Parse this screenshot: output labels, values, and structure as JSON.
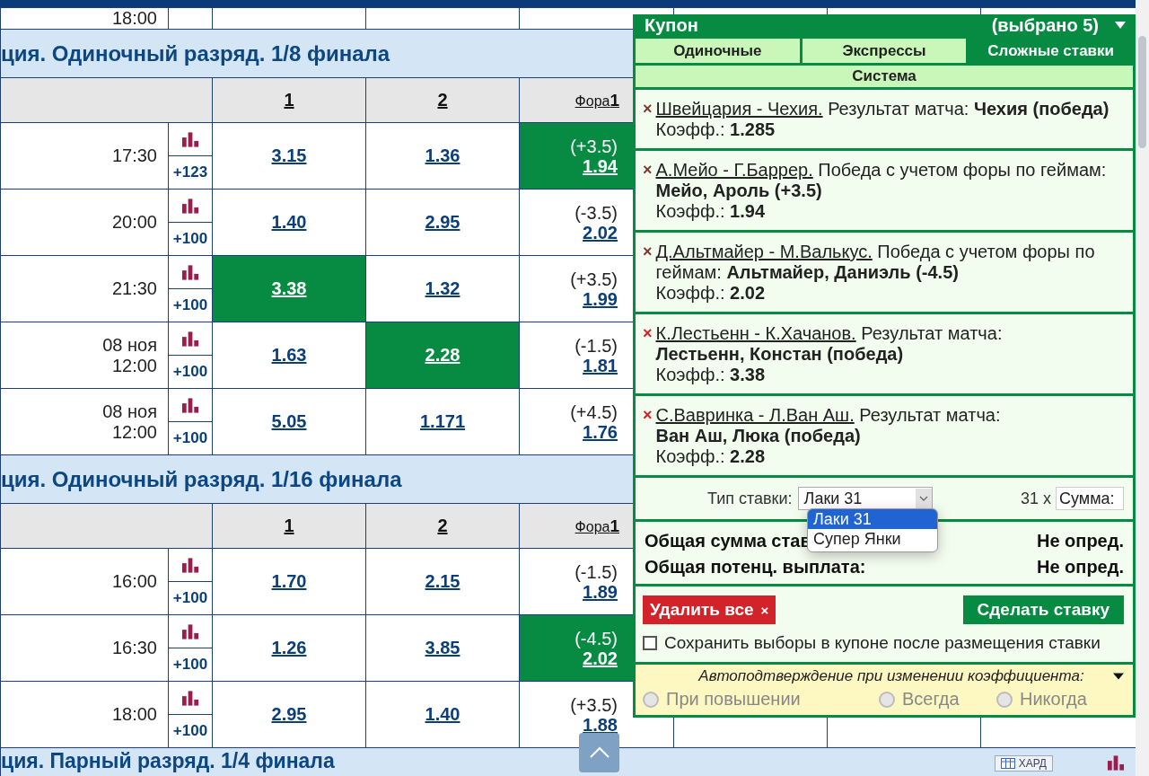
{
  "partial_row": {
    "time": "18:00"
  },
  "sections": [
    {
      "title": "ция. Одиночный разряд. 1/8 финала",
      "columns": [
        "1",
        "2",
        "Фора**1**"
      ],
      "rows": [
        {
          "time": "17:30",
          "more": "+123",
          "odds": [
            {
              "value": "3.15",
              "selected": false
            },
            {
              "value": "1.36",
              "selected": false
            }
          ],
          "handicap": {
            "line": "(+3.5)",
            "value": "1.94",
            "selected": true
          }
        },
        {
          "time": "20:00",
          "more": "+100",
          "odds": [
            {
              "value": "1.40",
              "selected": false
            },
            {
              "value": "2.95",
              "selected": false
            }
          ],
          "handicap": {
            "line": "(-3.5)",
            "value": "2.02",
            "selected": false
          }
        },
        {
          "time": "21:30",
          "more": "+100",
          "odds": [
            {
              "value": "3.38",
              "selected": true
            },
            {
              "value": "1.32",
              "selected": false
            }
          ],
          "handicap": {
            "line": "(+3.5)",
            "value": "1.99",
            "selected": false
          }
        },
        {
          "date": "08 ноя",
          "time": "12:00",
          "more": "+100",
          "odds": [
            {
              "value": "1.63",
              "selected": false
            },
            {
              "value": "2.28",
              "selected": true
            }
          ],
          "handicap": {
            "line": "(-1.5)",
            "value": "1.81",
            "selected": false
          }
        },
        {
          "date": "08 ноя",
          "time": "12:00",
          "more": "+100",
          "odds": [
            {
              "value": "5.05",
              "selected": false
            },
            {
              "value": "1.171",
              "selected": false
            }
          ],
          "handicap": {
            "line": "(+4.5)",
            "value": "1.76",
            "selected": false
          }
        }
      ]
    },
    {
      "title": "ция. Одиночный разряд. 1/16 финала",
      "columns": [
        "1",
        "2",
        "Фора**1**"
      ],
      "rows": [
        {
          "time": "16:00",
          "more": "+100",
          "odds": [
            {
              "value": "1.70",
              "selected": false
            },
            {
              "value": "2.15",
              "selected": false
            }
          ],
          "handicap": {
            "line": "(-1.5)",
            "value": "1.89",
            "selected": false
          }
        },
        {
          "time": "16:30",
          "more": "+100",
          "odds": [
            {
              "value": "1.26",
              "selected": false
            },
            {
              "value": "3.85",
              "selected": false
            }
          ],
          "handicap": {
            "line": "(-4.5)",
            "value": "2.02",
            "selected": true
          }
        },
        {
          "time": "18:00",
          "more": "+100",
          "odds": [
            {
              "value": "2.95",
              "selected": false
            },
            {
              "value": "1.40",
              "selected": false
            }
          ],
          "handicap": {
            "line": "(+3.5)",
            "value": "1.88",
            "selected": false
          }
        }
      ]
    }
  ],
  "next_section": {
    "title": "ция. Парный разряд. 1/4 финала",
    "badge": "ХАРД"
  },
  "coupon": {
    "title": "Купон",
    "count": "(выбрано 5)",
    "tabs": [
      {
        "label": "Одиночные",
        "selected": false
      },
      {
        "label": "Экспрессы",
        "selected": false
      },
      {
        "label": "Сложные ставки",
        "selected": true
      }
    ],
    "subtab": "Система",
    "bets": [
      {
        "match": "Швейцария - Чехия.",
        "market": "Результат матча:",
        "pick": "Чехия (победа)",
        "odds_label": "Коэфф.:",
        "odds": "1.285",
        "remove": "×",
        "color": "#7b3b32"
      },
      {
        "match": "А.Мейо - Г.Баррер.",
        "market": "Победа с учетом форы по геймам:",
        "pick": "Мейо, Ароль (+3.5)",
        "odds_label": "Коэфф.:",
        "odds": "1.94",
        "remove": "×",
        "color": "#7b3b32"
      },
      {
        "match": "Д.Альтмайер - М.Валькус.",
        "market": "Победа с учетом форы по геймам:",
        "pick": "Альтмайер, Даниэль (-4.5)",
        "odds_label": "Коэфф.:",
        "odds": "2.02",
        "remove": "×",
        "color": "#7b3b32"
      },
      {
        "match": "К.Лестьенн - К.Хачанов.",
        "market": "Результат матча:",
        "pick": "Лестьенн, Констан (победа)",
        "odds_label": "Коэфф.:",
        "odds": "3.38",
        "remove": "×",
        "color": "#d42027"
      },
      {
        "match": "С.Вавринка - Л.Ван Аш.",
        "market": "Результат матча:",
        "pick": "Ван Аш, Люка (победа)",
        "odds_label": "Коэфф.:",
        "odds": "2.28",
        "remove": "×",
        "color": "#d42027"
      }
    ],
    "stake": {
      "label": "Тип ставки:",
      "type": "Лаки 31",
      "multiplier": "31 x",
      "placeholder": "Сумма:",
      "options": [
        {
          "label": "Лаки 31",
          "selected": true
        },
        {
          "label": "Супер Янки",
          "selected": false
        }
      ]
    },
    "totals": [
      {
        "label": "Общая сумма став",
        "value": "Не опред."
      },
      {
        "label": "Общая потенц. выплата:",
        "value": "Не опред."
      }
    ],
    "delete_button": {
      "label": "Удалить все",
      "mark": "×"
    },
    "place_button": "Сделать ставку",
    "keep": {
      "label": "Сохранить выборы в купоне после размещения ставки",
      "checked": false
    },
    "autoconfirm": {
      "title": "Автоподтверждение при изменении коэффициента:",
      "options": [
        {
          "label": "При повышении",
          "selected": false,
          "disabled": true
        },
        {
          "label": "Всегда",
          "selected": false,
          "disabled": true
        },
        {
          "label": "Никогда",
          "selected": false,
          "disabled": true
        }
      ]
    }
  }
}
